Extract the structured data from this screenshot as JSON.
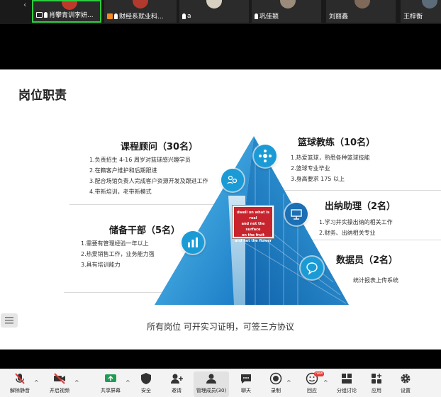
{
  "participants": [
    {
      "name": "肖攀青训李妍...",
      "indicator": "screen-share",
      "active": true
    },
    {
      "name": "财经系就业科...",
      "indicator": "orange-mic",
      "active": false
    },
    {
      "name": "a",
      "indicator": "mic",
      "active": false
    },
    {
      "name": "巩佳颖",
      "indicator": "mic",
      "active": false
    },
    {
      "name": "刘丽鑫",
      "indicator": "none",
      "active": false
    },
    {
      "name": "王梓衡",
      "indicator": "none",
      "active": false
    }
  ],
  "slide": {
    "title": "岗位职责",
    "roles": {
      "course_advisor": {
        "heading": "课程顾问（30名）",
        "duties": [
          "1.负责招生 4-16 周岁对篮球感兴趣学员",
          "2.在籍客户维护和后期跟进",
          "3.配合场馆负责人完成客户资源开发及跟进工作",
          "4.带新培训，老带新模式"
        ]
      },
      "basketball_coach": {
        "heading": "篮球教练（10名）",
        "duties": [
          "1.热爱篮球，熟悉各种篮球技能",
          "2.篮球专业毕业",
          "3.身高要求 175 以上"
        ]
      },
      "reserve_cadre": {
        "heading": "储备干部（5名）",
        "duties": [
          "1.需要有管理经验一年以上",
          "2.热爱销售工作，业务能力强",
          "3.具有培训能力"
        ]
      },
      "cashier_assistant": {
        "heading": "出纳助理（2名）",
        "duties": [
          "1.学习并实操出纳的相关工作",
          "2.财务、出纳相关专业"
        ]
      },
      "data_clerk": {
        "heading": "数据员（2名）",
        "duties": [
          "统计报表上传系统"
        ]
      }
    },
    "sign_text": [
      "dwell on what is real",
      "and not the surface",
      "on the fruit",
      "and not the flower"
    ],
    "footer": "所有岗位 可开实习证明，可签三方协议"
  },
  "toolbar": {
    "items": [
      {
        "label": "解除静音",
        "icon": "muted-mic-icon",
        "caret": true
      },
      {
        "label": "开启视频",
        "icon": "video-off-icon",
        "caret": true
      },
      {
        "label": "共享屏幕",
        "icon": "share-screen-icon",
        "caret": true
      },
      {
        "label": "安全",
        "icon": "shield-icon",
        "caret": false
      },
      {
        "label": "邀请",
        "icon": "invite-icon",
        "caret": false
      },
      {
        "label": "管理成员(30)",
        "icon": "members-icon",
        "caret": false
      },
      {
        "label": "聊天",
        "icon": "chat-icon",
        "caret": false
      },
      {
        "label": "录制",
        "icon": "record-icon",
        "caret": true
      },
      {
        "label": "回应",
        "icon": "reaction-icon",
        "caret": true,
        "badge": "new"
      },
      {
        "label": "分组讨论",
        "icon": "breakout-icon",
        "caret": false
      },
      {
        "label": "应用",
        "icon": "apps-icon",
        "caret": false
      },
      {
        "label": "设置",
        "icon": "gear-icon",
        "caret": false
      }
    ]
  },
  "colors": {
    "accent_green": "#2ecc40",
    "triangle_blue": "#1b9bd6",
    "record_red": "#e53935"
  }
}
